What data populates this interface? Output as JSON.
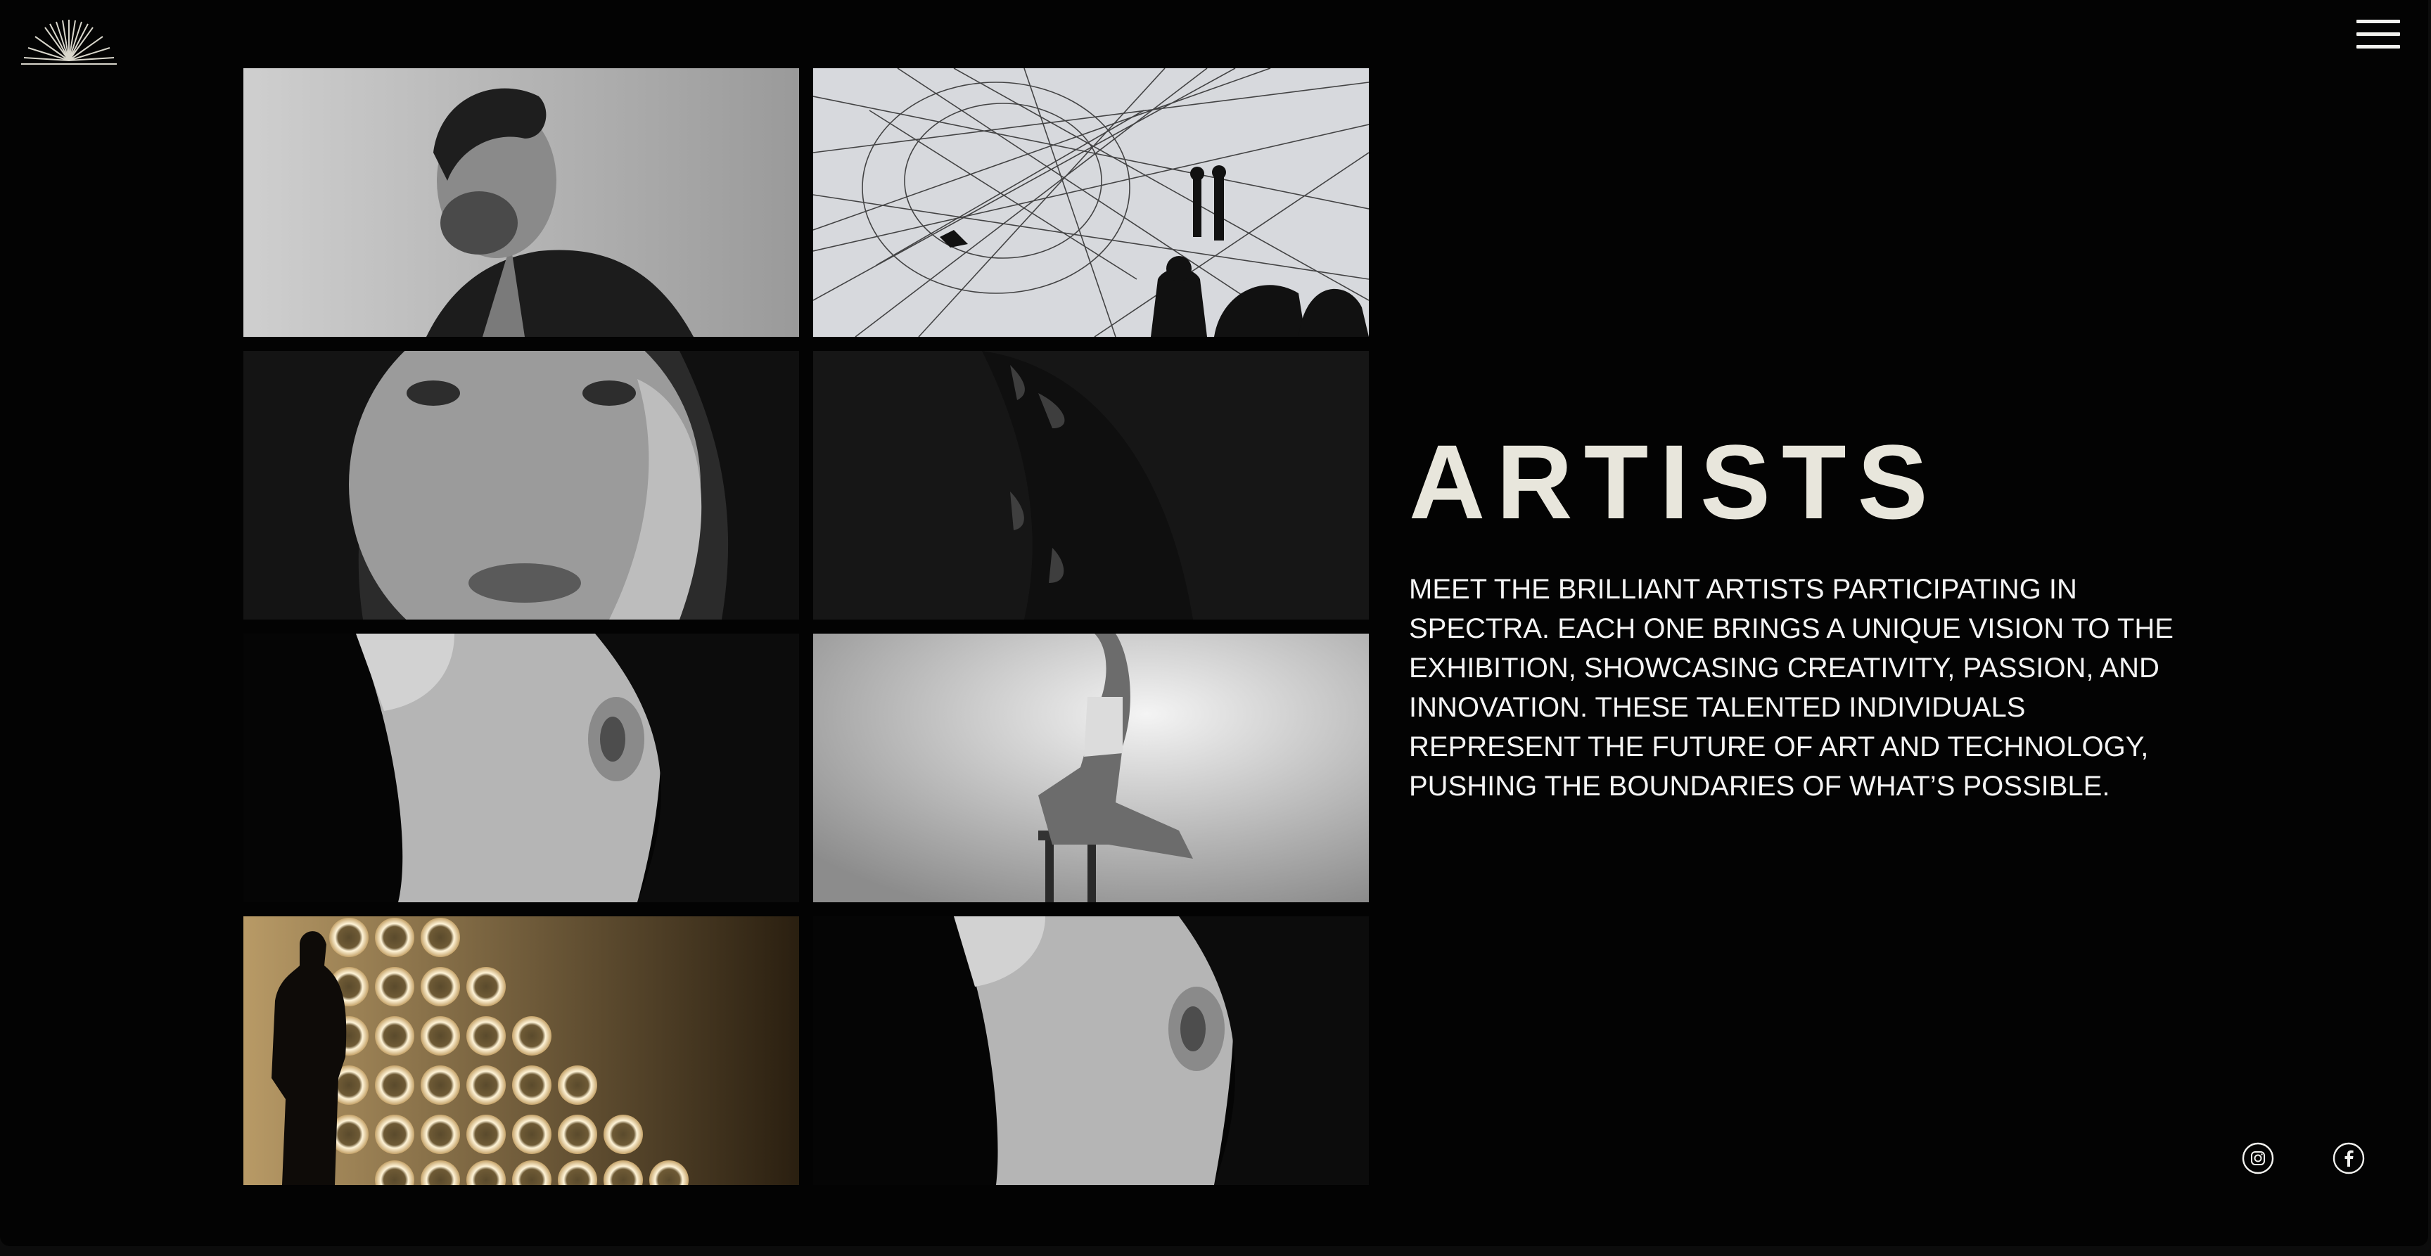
{
  "header": {
    "logo_icon": "sunburst-logo-icon",
    "menu_icon": "hamburger-menu-icon"
  },
  "gallery": {
    "tiles": [
      {
        "icon": "artist-photo-man-portrait"
      },
      {
        "icon": "artist-photo-string-installation"
      },
      {
        "icon": "artist-photo-freckled-face"
      },
      {
        "icon": "artist-photo-dark-abstract"
      },
      {
        "icon": "artist-photo-neck-profile"
      },
      {
        "icon": "artist-photo-woman-on-stool"
      },
      {
        "icon": "artist-photo-light-wall-silhouette"
      },
      {
        "icon": "artist-photo-neck-profile"
      }
    ]
  },
  "main": {
    "title": "ARTISTS",
    "description": "MEET THE BRILLIANT ARTISTS PARTICIPATING IN SPECTRA. EACH ONE BRINGS A UNIQUE VISION TO THE EXHIBITION, SHOWCASING CREATIVITY, PASSION, AND INNOVATION. THESE TALENTED INDIVIDUALS REPRESENT THE FUTURE OF ART AND TECHNOLOGY, PUSHING THE BOUNDARIES OF WHAT’S POSSIBLE."
  },
  "social": {
    "instagram_icon": "instagram-icon",
    "facebook_icon": "facebook-icon"
  },
  "colors": {
    "background": "#030303",
    "title": "#e8e6dc",
    "text": "#f4f4f4"
  }
}
